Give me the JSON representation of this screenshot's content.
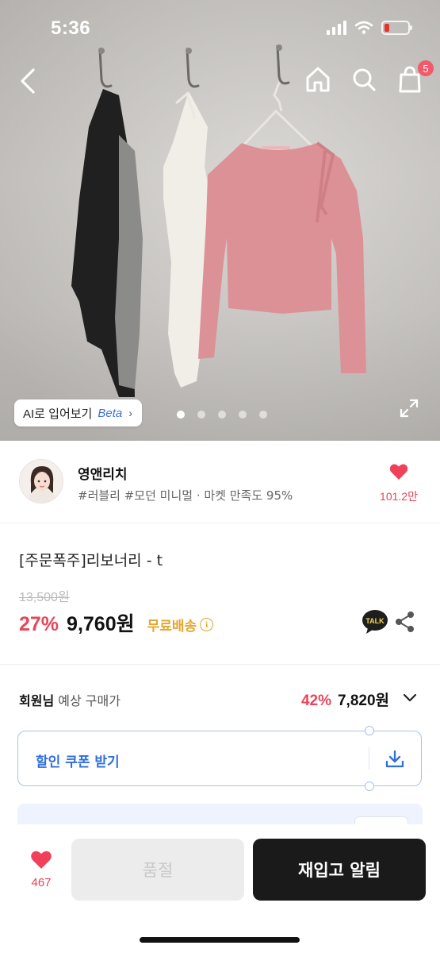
{
  "status_bar": {
    "time": "5:36",
    "battery_color": "#e5332a",
    "battery_level_percent": 15
  },
  "nav": {
    "back_icon": "chevron-left-icon",
    "home_icon": "home-icon",
    "search_icon": "search-icon",
    "cart_icon": "shopping-bag-icon",
    "cart_count": "5"
  },
  "gallery": {
    "ai_try_on_label": "AI로 입어보기",
    "ai_try_on_beta": "Beta",
    "ai_try_on_chevron": "›",
    "page_count": 5,
    "active_page": 1,
    "expand_icon": "expand-icon"
  },
  "shop": {
    "name": "영앤리치",
    "tags": "#러블리 #모던 미니멀 · 마켓 만족도 95%",
    "like_count": "101.2만",
    "heart_color": "#f0405a"
  },
  "product": {
    "name": "[주문폭주]리보너리 - t",
    "original_price": "13,500원",
    "discount": "27%",
    "sale_price": "9,760원",
    "free_shipping": "무료배송",
    "info_glyph": "i",
    "talk_label": "TALK"
  },
  "member": {
    "label_bold": "회원님",
    "label_rest": " 예상 구매가",
    "discount": "42%",
    "price": "7,820원"
  },
  "coupon": {
    "label": "할인 쿠폰 받기",
    "icon": "download-icon"
  },
  "bottom_bar": {
    "wish_count": "467",
    "soldout_label": "품절",
    "restock_label": "재입고 알림"
  },
  "colors": {
    "accent_red": "#e8455a",
    "coupon_blue": "#2f6fd8",
    "free_ship_yellow": "#e6a52d",
    "dark_button": "#1a1a1a"
  }
}
